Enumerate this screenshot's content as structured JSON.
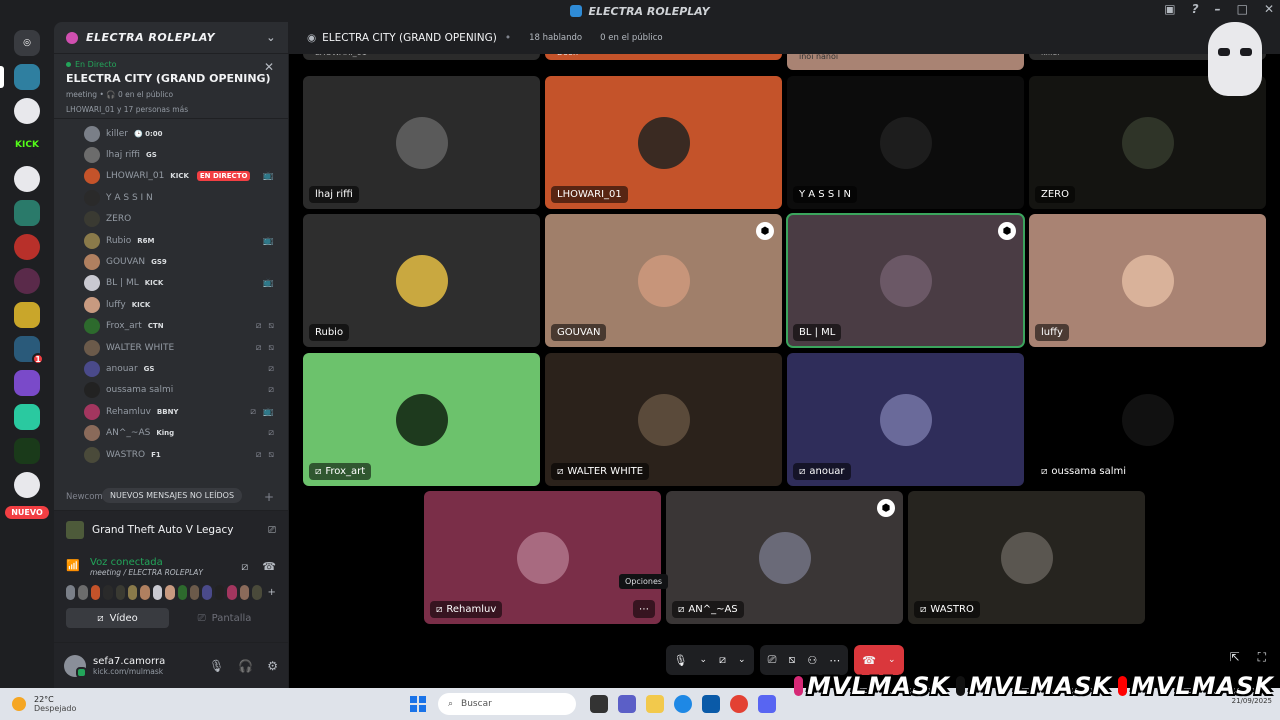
{
  "window": {
    "title": "ELECTRA ROLEPLAY",
    "controls": [
      "▣",
      "?",
      "–",
      "□",
      "✕"
    ]
  },
  "rail": {
    "nuevo_label": "NUEVO",
    "badge_count": "1"
  },
  "server": {
    "name": "ELECTRA ROLEPLAY"
  },
  "live": {
    "tag": "En Directo",
    "title": "ELECTRA CITY (GRAND OPENING)",
    "meta": "meeting • 🎧 0 en el público",
    "viewers": "LHOWARI_01 y 17 personas más"
  },
  "members": [
    {
      "name": "killer",
      "tag": "🕒 0:00",
      "color": "#7a7f88"
    },
    {
      "name": "lhaj riffi",
      "tag": "GS",
      "color": "#6c6c6c"
    },
    {
      "name": "LHOWARI_01",
      "tag": "KICK",
      "live": "EN DIRECTO",
      "color": "#c4532a",
      "icons": "📺"
    },
    {
      "name": "Y A S S I N",
      "tag": "",
      "color": "#2a2a2a"
    },
    {
      "name": "ZERO",
      "tag": "",
      "color": "#3a3a32"
    },
    {
      "name": "Rubio",
      "tag": "R6M",
      "color": "#8a7a4a",
      "icons": "📺"
    },
    {
      "name": "GOUVAN",
      "tag": "GS9",
      "color": "#b08060"
    },
    {
      "name": "BL | ML",
      "tag": "KICK",
      "color": "#c9c9d1",
      "icons": "📺"
    },
    {
      "name": "luffy",
      "tag": "KICK",
      "color": "#c89a80"
    },
    {
      "name": "Frox_art",
      "tag": "CTN",
      "color": "#2d6a2d",
      "icons": "⧄ ⧅"
    },
    {
      "name": "WALTER WHITE",
      "tag": "",
      "color": "#6b5a4a",
      "icons": "⧄ ⧅"
    },
    {
      "name": "anouar",
      "tag": "GS",
      "color": "#4a4a8a",
      "icons": "⧄"
    },
    {
      "name": "oussama salmi",
      "tag": "",
      "color": "#222222",
      "icons": "⧄"
    },
    {
      "name": "Rehamluv",
      "tag": "BBNY",
      "color": "#a3365f",
      "icons": "⧄ 📺"
    },
    {
      "name": "AN^_~AS",
      "tag": "King",
      "color": "#8a6a5a",
      "icons": "⧄"
    },
    {
      "name": "WASTRO",
      "tag": "F1",
      "color": "#4a4a3a",
      "icons": "⧄ ⧅"
    }
  ],
  "sidebar": {
    "new_messages": "NUEVOS MENSAJES NO LEÍDOS",
    "newcomers": "Newcom",
    "plus": "+"
  },
  "voice": {
    "game": "Grand Theft Auto V Legacy",
    "connected": "Voz conectada",
    "channel": "meeting / ELECTRA ROLEPLAY",
    "video_button": "Vídeo",
    "screen_button": "Pantalla"
  },
  "user": {
    "name": "sefa7.camorra",
    "sub": "kick.com/mulmask"
  },
  "stage": {
    "title": "ELECTRA CITY (GRAND OPENING)",
    "speaking": "18 hablando",
    "audience": "0 en el público"
  },
  "top_strip": [
    "LHOWARI_01",
    "Doon",
    "inoi nanoi",
    "killer"
  ],
  "tiles": [
    {
      "name": "lhaj riffi",
      "bg": "#2b2b2b",
      "av": "#5a5a5a"
    },
    {
      "name": "LHOWARI_01",
      "bg": "#c4532a",
      "av": "#3a2a22"
    },
    {
      "name": "Y A S S I N",
      "bg": "#0c0c0c",
      "av": "#1d1d1d"
    },
    {
      "name": "ZERO",
      "bg": "#141411",
      "av": "#2f3428"
    },
    {
      "name": "Rubio",
      "bg": "#2e2e2e",
      "av": "#c9a840"
    },
    {
      "name": "GOUVAN",
      "bg": "#a07f6a",
      "av": "#c7957a"
    },
    {
      "name": "BL | ML",
      "bg": "#4a3c44",
      "av": "#6b5866"
    },
    {
      "name": "luffy",
      "bg": "#a98373",
      "av": "#d9b29a"
    },
    {
      "name": "Frox_art",
      "bg": "#6cc26c",
      "av": "#1e3a1e"
    },
    {
      "name": "WALTER WHITE",
      "bg": "#2b221b",
      "av": "#5a4a3a"
    },
    {
      "name": "anouar",
      "bg": "#2f2d5a",
      "av": "#6a6a9a"
    },
    {
      "name": "oussama salmi",
      "bg": "#000000",
      "av": "#111111"
    },
    {
      "name": "Rehamluv",
      "bg": "#7a2e48",
      "av": "#a86a80"
    },
    {
      "name": "AN^_~AS",
      "bg": "#3a3636",
      "av": "#6a6a78"
    },
    {
      "name": "WASTRO",
      "bg": "#26241f",
      "av": "#5a5650"
    }
  ],
  "tooltip": "Opciones",
  "social": {
    "handle": "MVLMASK"
  },
  "taskbar": {
    "temp": "22°C",
    "weather": "Despejado",
    "search": "Buscar",
    "date": "21/09/2025"
  }
}
